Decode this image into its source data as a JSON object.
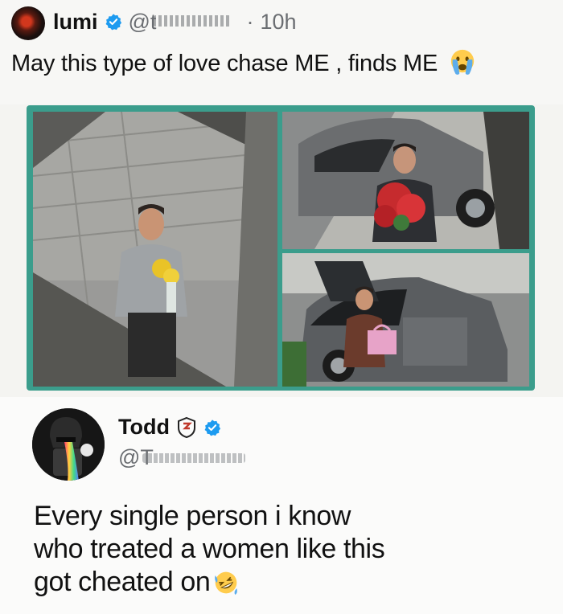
{
  "tweet": {
    "author_name": "lumi",
    "handle_prefix": "@t",
    "separator": "·",
    "time": "10h",
    "text": "May this type of love chase ME , finds ME",
    "emoji": "crying-face"
  },
  "reply": {
    "author_name": "Todd",
    "handle_prefix": "@T",
    "lines": [
      "Every single person i know",
      "who treated a women like this",
      "got cheated on"
    ],
    "emoji": "rolling-laughing-face"
  },
  "colors": {
    "collage_border": "#3b9d8c",
    "verified": "#1d9bf0",
    "muted_text": "#6b6e72"
  }
}
